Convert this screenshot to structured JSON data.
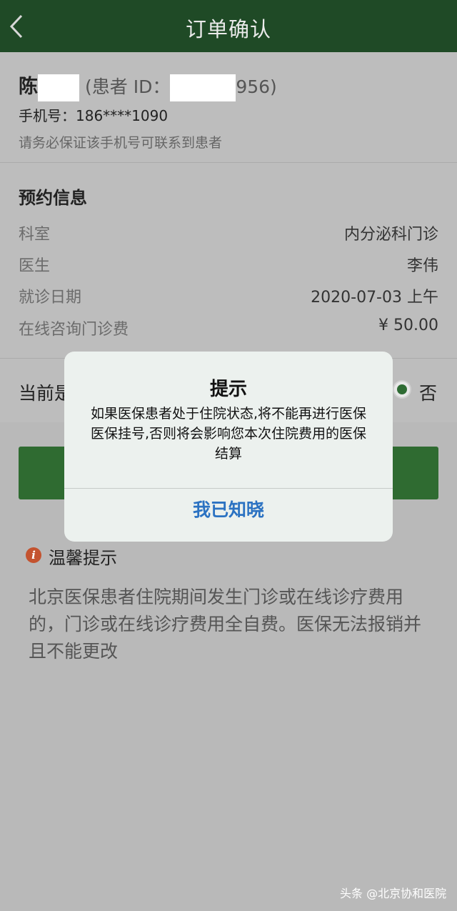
{
  "header": {
    "title": "订单确认"
  },
  "patient": {
    "surname": "陈",
    "id_label": "(患者 ID：",
    "id_suffix": "956)",
    "phone_label": "手机号：",
    "phone": "186****1090",
    "note": "请务必保证该手机号可联系到患者"
  },
  "appointment": {
    "title": "预约信息",
    "rows": [
      {
        "label": "科室",
        "value": "内分泌科门诊"
      },
      {
        "label": "医生",
        "value": "李伟"
      },
      {
        "label": "就诊日期",
        "value": "2020-07-03  上午"
      },
      {
        "label": "在线咨询门诊费",
        "value": "¥ 50.00"
      }
    ]
  },
  "inpatient": {
    "label": "当前是",
    "option_no": "否"
  },
  "tips": {
    "title": "温馨提示",
    "text": "北京医保患者住院期间发生门诊或在线诊疗费用的，门诊或在线诊疗费用全自费。医保无法报销并且不能更改"
  },
  "dialog": {
    "title": "提示",
    "body": "如果医保患者处于住院状态,将不能再进行医保医保挂号,否则将会影响您本次住院费用的医保结算",
    "button": "我已知晓"
  },
  "watermark": "头条 @北京协和医院",
  "colors": {
    "header": "#1f4a26",
    "primary": "#2f6b31",
    "link": "#2b72c2",
    "tips_icon": "#c4532f"
  }
}
